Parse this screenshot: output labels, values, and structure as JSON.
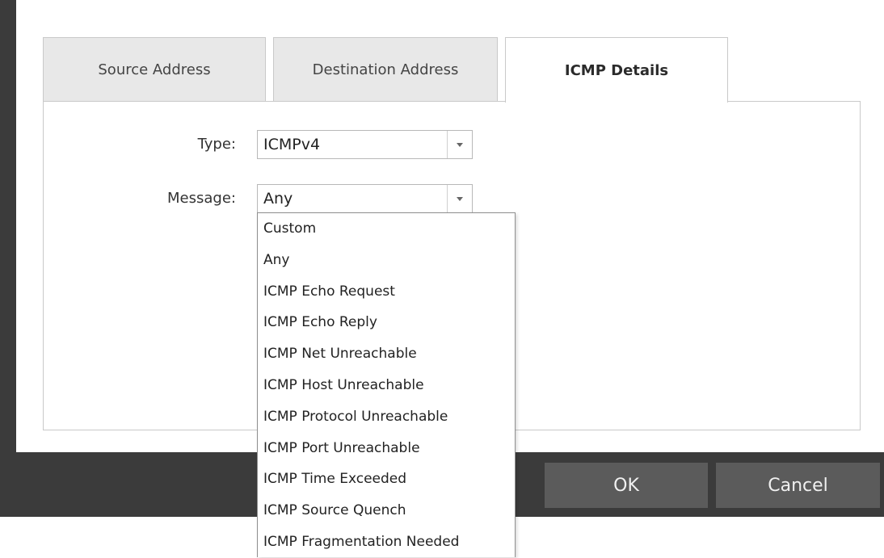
{
  "tabs": [
    {
      "label": "Source Address",
      "active": false
    },
    {
      "label": "Destination Address",
      "active": false
    },
    {
      "label": "ICMP Details",
      "active": true
    }
  ],
  "form": {
    "type_label": "Type:",
    "type_value": "ICMPv4",
    "message_label": "Message:",
    "message_value": "Any"
  },
  "message_options": [
    "Custom",
    "Any",
    "ICMP Echo Request",
    "ICMP Echo Reply",
    "ICMP Net Unreachable",
    "ICMP Host Unreachable",
    "ICMP Protocol Unreachable",
    "ICMP Port Unreachable",
    "ICMP Time Exceeded",
    "ICMP Source Quench",
    "ICMP Fragmentation Needed"
  ],
  "buttons": {
    "ok": "OK",
    "cancel": "Cancel"
  }
}
